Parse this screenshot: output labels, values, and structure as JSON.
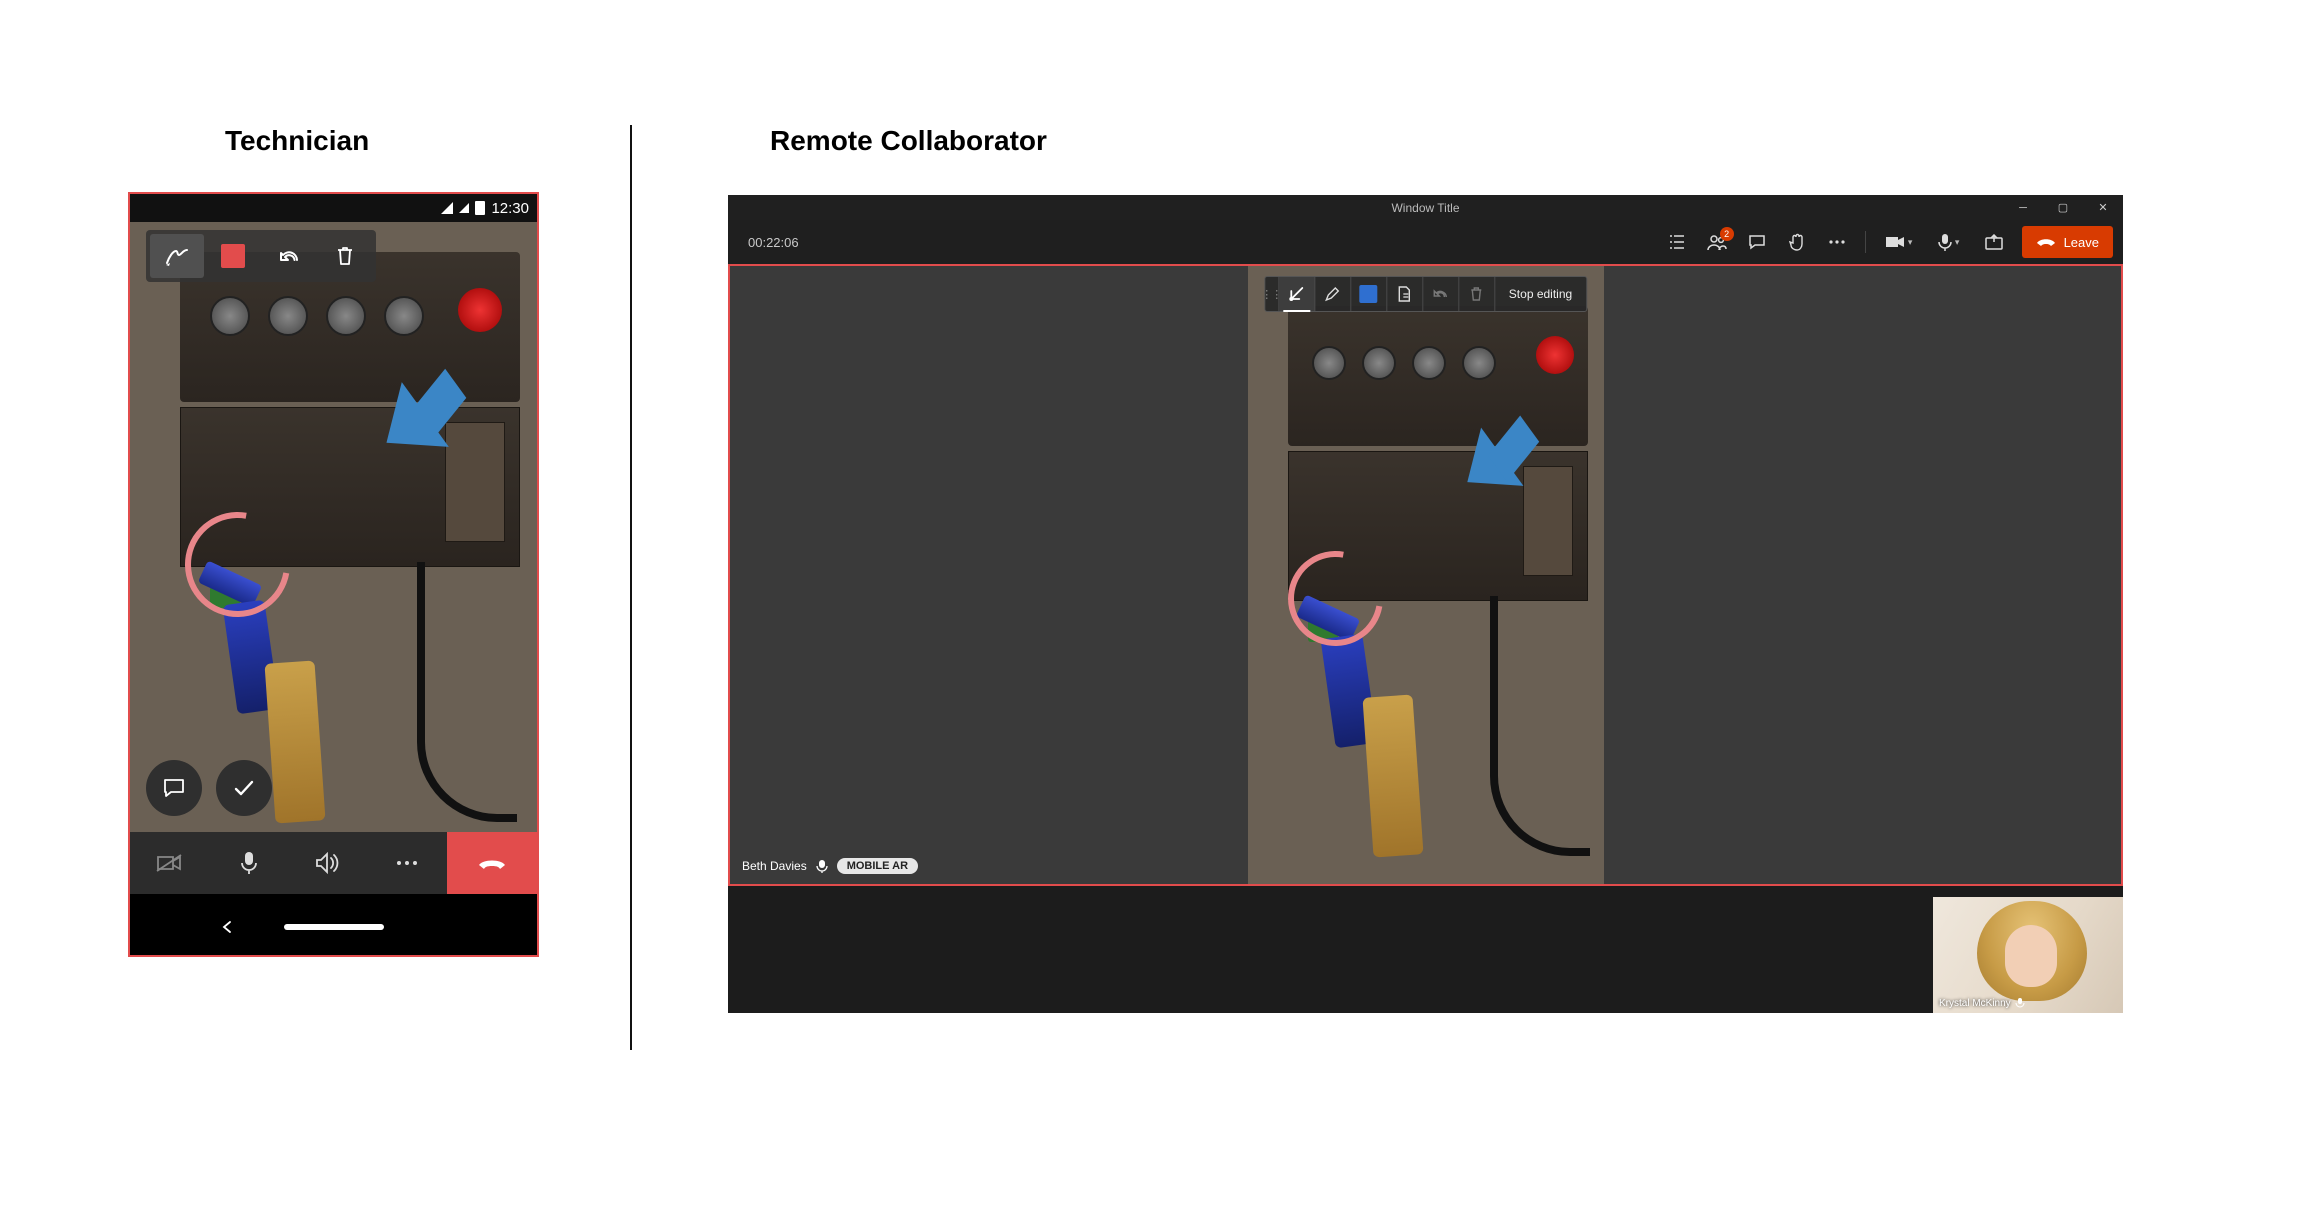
{
  "headings": {
    "technician": "Technician",
    "remote": "Remote Collaborator"
  },
  "phone": {
    "status_time": "12:30",
    "ar_toolbar": {
      "draw": "draw",
      "color": "color",
      "undo": "undo",
      "delete": "delete"
    },
    "callbar": {
      "camera": "camera-off",
      "mic": "mic",
      "speaker": "speaker",
      "more": "more",
      "hangup": "hangup"
    }
  },
  "teams": {
    "window_title": "Window Title",
    "call_timer": "00:22:06",
    "toolbar": {
      "people_badge": "2",
      "leave_label": "Leave"
    },
    "anno_toolbar": {
      "stop_editing": "Stop editing"
    },
    "participant": {
      "name": "Beth Davies",
      "pill": "MOBILE AR"
    },
    "pip_name": "Krystal McKinny"
  }
}
